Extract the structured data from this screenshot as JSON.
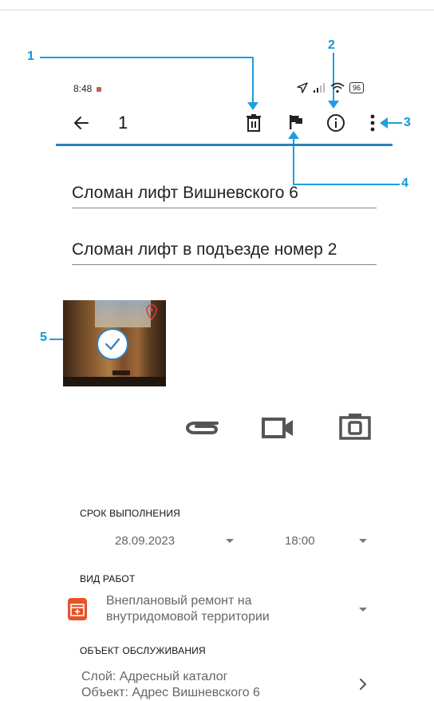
{
  "callouts": [
    "1",
    "2",
    "3",
    "4",
    "5"
  ],
  "status_bar": {
    "time": "8:48",
    "battery": "96"
  },
  "toolbar": {
    "title": "1",
    "icons": [
      "back-arrow-icon",
      "trash-icon",
      "flag-icon",
      "info-icon",
      "more-vert-icon"
    ]
  },
  "form": {
    "title_value": "Сломан лифт Вишневского 6",
    "description_value": "Сломан лифт в подъезде номер 2"
  },
  "attachments": {
    "media_icons": [
      "paperclip-icon",
      "video-camera-icon",
      "photo-camera-icon"
    ]
  },
  "deadline": {
    "label": "СРОК ВЫПОЛНЕНИЯ",
    "date": "28.09.2023",
    "time": "18:00"
  },
  "work_type": {
    "label": "ВИД РАБОТ",
    "line1": "Внеплановый ремонт на",
    "line2": "внутридомовой территории"
  },
  "service_object": {
    "label": "ОБЪЕКТ ОБСЛУЖИВАНИЯ",
    "line1": "Слой: Адресный каталог",
    "line2": "Объект: Адрес  Вишневского 6"
  },
  "colors": {
    "accent_blue": "#2b7fc1",
    "callout_blue": "#1e9ee0",
    "work_icon_orange": "#e8532a"
  }
}
